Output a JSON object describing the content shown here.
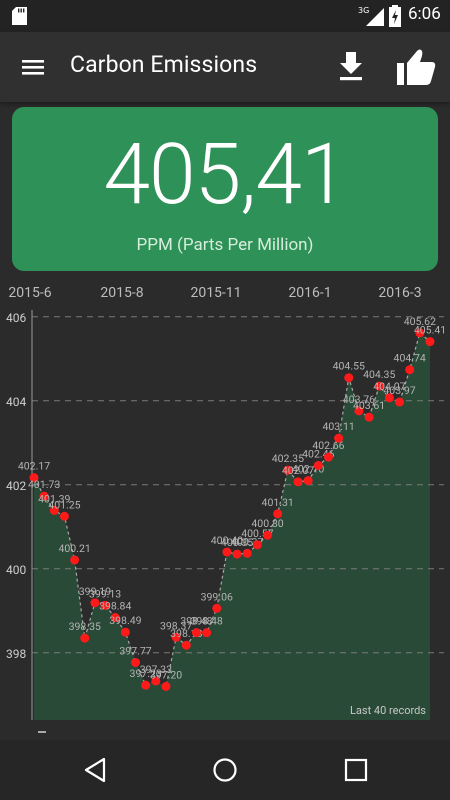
{
  "status_bar": {
    "time": "6:06",
    "network": "3G"
  },
  "app_bar": {
    "title": "Carbon Emissions"
  },
  "card": {
    "value": "405,41",
    "unit": "PPM (Parts Per Million)",
    "color": "#2e9157"
  },
  "chart_data": {
    "type": "line",
    "x_tick_labels": [
      "2015-6",
      "2015-8",
      "2015-11",
      "2016-1",
      "2016-3"
    ],
    "y_ticks": [
      398,
      400,
      402,
      404,
      406
    ],
    "ylim": [
      396.4,
      406.4
    ],
    "note": "Last 40 records",
    "series": [
      {
        "values": [
          402.17,
          401.73,
          401.39,
          401.25,
          400.21,
          398.35,
          399.19,
          399.13,
          398.84,
          398.49,
          397.77,
          397.23,
          397.33,
          397.2,
          398.37,
          398.18,
          398.48,
          398.48,
          399.06,
          400.4,
          400.35,
          400.37,
          400.57,
          400.8,
          401.31,
          402.35,
          402.07,
          402.1,
          402.46,
          402.66,
          403.11,
          404.55,
          403.76,
          403.61,
          404.35,
          404.07,
          403.97,
          404.74,
          405.62,
          405.41
        ]
      }
    ],
    "point_color": "#ff1a1a",
    "area_color": "#2a4a38",
    "line_color": "#a9a9a9"
  }
}
